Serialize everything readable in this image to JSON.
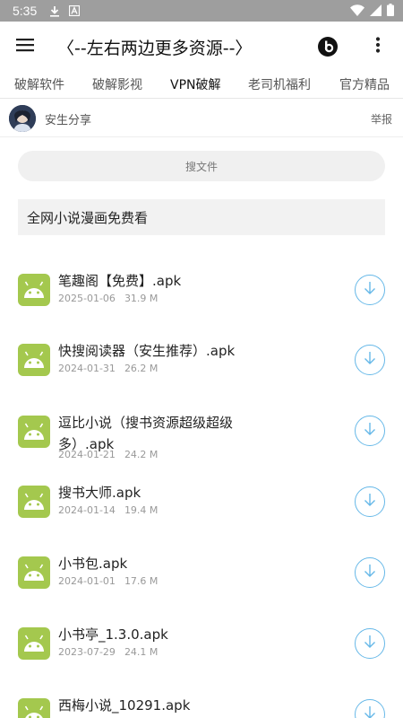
{
  "status_bar": {
    "time": "5:35",
    "icons": [
      "download-icon",
      "notification-a-icon",
      "wifi-icon",
      "cellular-icon",
      "battery-icon"
    ]
  },
  "app_bar": {
    "title": "〈--左右两边更多资源--〉",
    "menu_icon": "hamburger-menu-icon",
    "beats_icon": "beats-logo-icon",
    "more_icon": "more-vertical-icon"
  },
  "tabs": [
    {
      "label": "破解软件",
      "active": false
    },
    {
      "label": "破解影视",
      "active": false
    },
    {
      "label": "VPN破解",
      "active": true
    },
    {
      "label": "老司机福利",
      "active": false
    },
    {
      "label": "官方精品",
      "active": false
    }
  ],
  "author": {
    "name": "安生分享",
    "report": "举报"
  },
  "search": {
    "placeholder": "搜文件"
  },
  "folder": {
    "title": "全网小说漫画免费看"
  },
  "files": [
    {
      "name": "笔趣阁【免费】.apk",
      "date": "2025-01-06",
      "size": "31.9 M"
    },
    {
      "name": "快搜阅读器（安生推荐）.apk",
      "date": "2024-01-31",
      "size": "26.2 M"
    },
    {
      "name": "逗比小说（搜书资源超级超级多）.apk",
      "date": "2024-01-21",
      "size": "24.2 M"
    },
    {
      "name": "搜书大师.apk",
      "date": "2024-01-14",
      "size": "19.4 M"
    },
    {
      "name": "小书包.apk",
      "date": "2024-01-01",
      "size": "17.6 M"
    },
    {
      "name": "小书亭_1.3.0.apk",
      "date": "2023-07-29",
      "size": "24.1 M"
    },
    {
      "name": "西梅小说_10291.apk",
      "date": "",
      "size": ""
    }
  ],
  "colors": {
    "status_bar": "#9e9e9e",
    "apk_icon": "#a4c84e",
    "download_accent": "#66b8e8"
  }
}
